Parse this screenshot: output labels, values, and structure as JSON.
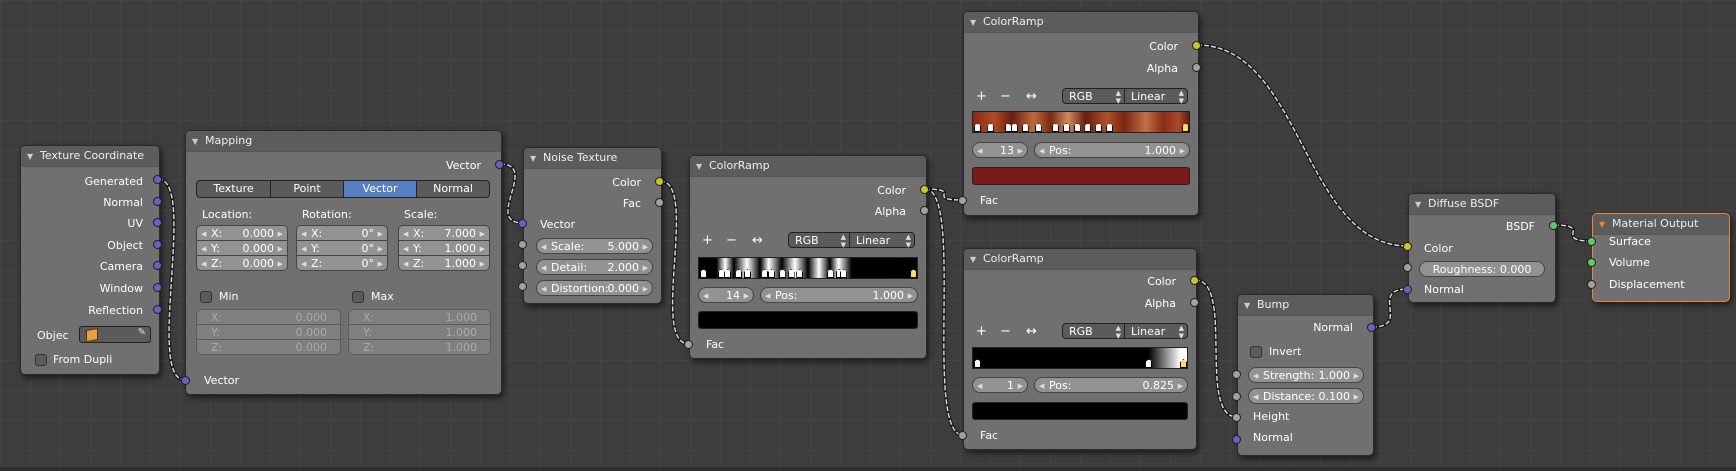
{
  "colors": {
    "background": "#3d3d3d",
    "node": "#707070",
    "active_tab": "#5680c2",
    "socket_vector": "#6363c7",
    "socket_color": "#c7c729",
    "socket_float": "#a1a1a1",
    "socket_shader": "#63c763",
    "selected_outline": "#e8892f"
  },
  "texture_coordinate": {
    "title": "Texture Coordinate",
    "outputs": [
      "Generated",
      "Normal",
      "UV",
      "Object",
      "Camera",
      "Window",
      "Reflection"
    ],
    "object_label": "Objec",
    "object_icon": "cube-icon",
    "picker_icon": "eyedropper-icon",
    "from_dupli_label": "From Dupli",
    "from_dupli_checked": false
  },
  "mapping": {
    "title": "Mapping",
    "output": "Vector",
    "tabs": [
      "Texture",
      "Point",
      "Vector",
      "Normal"
    ],
    "active_tab": "Vector",
    "location_label": "Location:",
    "rotation_label": "Rotation:",
    "scale_label": "Scale:",
    "location": [
      {
        "axis": "X:",
        "value": "0.000"
      },
      {
        "axis": "Y:",
        "value": "0.000"
      },
      {
        "axis": "Z:",
        "value": "0.000"
      }
    ],
    "rotation": [
      {
        "axis": "X:",
        "value": "0°"
      },
      {
        "axis": "Y:",
        "value": "0°"
      },
      {
        "axis": "Z:",
        "value": "0°"
      }
    ],
    "scale": [
      {
        "axis": "X:",
        "value": "7.000"
      },
      {
        "axis": "Y:",
        "value": "1.000"
      },
      {
        "axis": "Z:",
        "value": "1.000"
      }
    ],
    "min_label": "Min",
    "max_label": "Max",
    "min": [
      {
        "axis": "X:",
        "value": "0.000"
      },
      {
        "axis": "Y:",
        "value": "0.000"
      },
      {
        "axis": "Z:",
        "value": "0.000"
      }
    ],
    "max": [
      {
        "axis": "X:",
        "value": "1.000"
      },
      {
        "axis": "Y:",
        "value": "1.000"
      },
      {
        "axis": "Z:",
        "value": "1.000"
      }
    ],
    "input": "Vector"
  },
  "noise_texture": {
    "title": "Noise Texture",
    "outputs": [
      "Color",
      "Fac"
    ],
    "input_vector": "Vector",
    "fields": [
      {
        "label": "Scale:",
        "value": "5.000"
      },
      {
        "label": "Detail:",
        "value": "2.000"
      },
      {
        "label": "Distortion:",
        "value": "0.000"
      }
    ]
  },
  "colorramp_1": {
    "title": "ColorRamp",
    "outputs": [
      "Color",
      "Alpha"
    ],
    "add": "+",
    "remove": "−",
    "flip": "↔",
    "mode": "RGB",
    "interp": "Linear",
    "index": "14",
    "pos_label": "Pos:",
    "pos": "1.000",
    "stop_count": 14,
    "swatch_color": "#000000",
    "input": "Fac"
  },
  "colorramp_2": {
    "title": "ColorRamp",
    "outputs": [
      "Color",
      "Alpha"
    ],
    "add": "+",
    "remove": "−",
    "flip": "↔",
    "mode": "RGB",
    "interp": "Linear",
    "index": "13",
    "pos_label": "Pos:",
    "pos": "1.000",
    "stop_count": 13,
    "swatch_color": "#7a1a1a",
    "input": "Fac"
  },
  "colorramp_3": {
    "title": "ColorRamp",
    "outputs": [
      "Color",
      "Alpha"
    ],
    "add": "+",
    "remove": "−",
    "flip": "↔",
    "mode": "RGB",
    "interp": "Linear",
    "index": "1",
    "pos_label": "Pos:",
    "pos": "0.825",
    "stop_count": 3,
    "swatch_color": "#000000",
    "input": "Fac"
  },
  "bump": {
    "title": "Bump",
    "output": "Normal",
    "invert_label": "Invert",
    "invert_checked": false,
    "fields": [
      {
        "label": "Strength:",
        "value": "1.000"
      },
      {
        "label": "Distance:",
        "value": "0.100"
      }
    ],
    "inputs": [
      "Height",
      "Normal"
    ]
  },
  "diffuse": {
    "title": "Diffuse BSDF",
    "output": "BSDF",
    "input_color": "Color",
    "roughness_label": "Roughness:",
    "roughness": "0.000",
    "input_normal": "Normal"
  },
  "material_output": {
    "title": "Material Output",
    "inputs": [
      "Surface",
      "Volume",
      "Displacement"
    ]
  }
}
